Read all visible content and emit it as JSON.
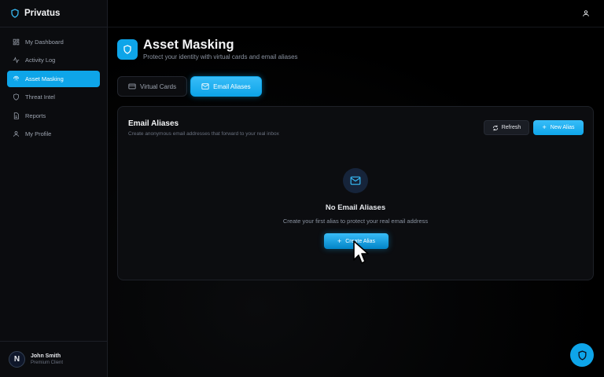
{
  "app": {
    "brand_name": "Privatus"
  },
  "sidebar": {
    "items": [
      {
        "label": "My Dashboard",
        "icon": "dashboard-icon",
        "active": false
      },
      {
        "label": "Activity Log",
        "icon": "activity-icon",
        "active": false
      },
      {
        "label": "Asset Masking",
        "icon": "fingerprint-icon",
        "active": true
      },
      {
        "label": "Threat Intel",
        "icon": "shield-icon",
        "active": false
      },
      {
        "label": "Reports",
        "icon": "file-icon",
        "active": false
      },
      {
        "label": "My Profile",
        "icon": "user-icon",
        "active": false
      }
    ],
    "user": {
      "initial": "N",
      "name": "John Smith",
      "role": "Premium Client"
    }
  },
  "header": {
    "title": "Asset Masking",
    "subtitle": "Protect your identity with virtual cards and email aliases"
  },
  "tabs": [
    {
      "label": "Virtual Cards",
      "icon": "credit-card-icon",
      "active": false
    },
    {
      "label": "Email Aliases",
      "icon": "mail-icon",
      "active": true
    }
  ],
  "panel": {
    "title": "Email Aliases",
    "description": "Create anonymous email addresses that forward to your real inbox",
    "refresh_label": "Refresh",
    "new_label": "New Alias",
    "empty_title": "No Email Aliases",
    "empty_description": "Create your first alias to protect your real email address",
    "create_label": "Create Alias"
  },
  "colors": {
    "accent": "#0ea5e9",
    "background": "#000000",
    "sidebar": "#0b0c0f",
    "panel": "#0c0d10"
  }
}
